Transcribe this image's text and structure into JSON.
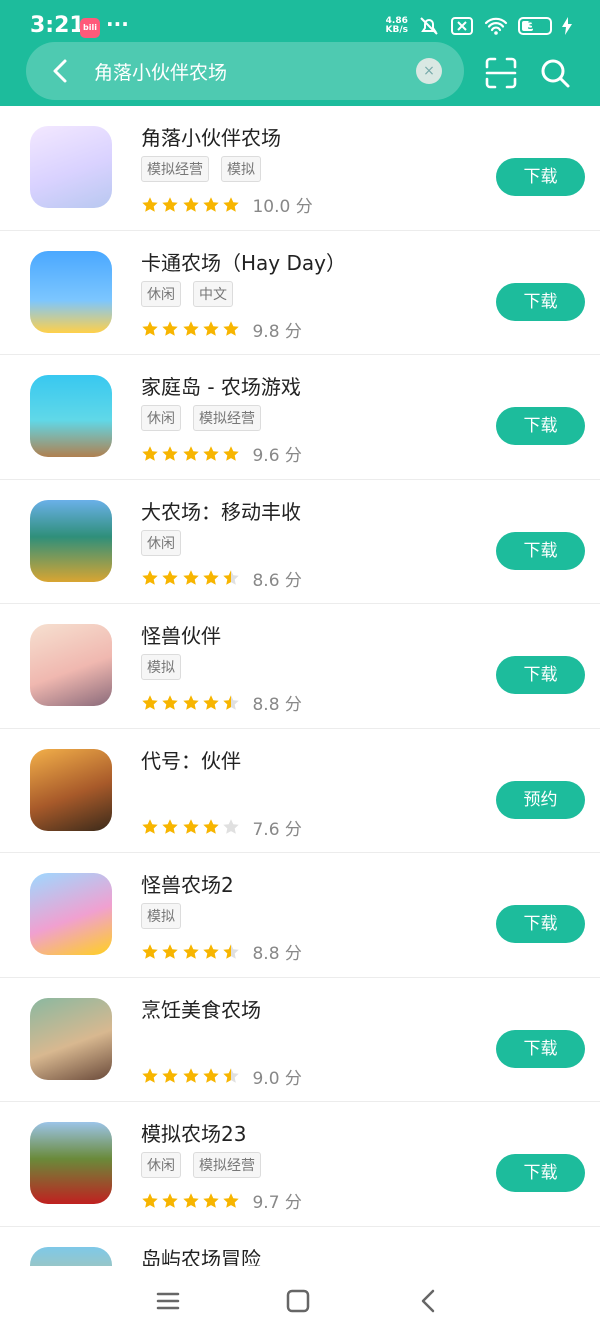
{
  "status_bar": {
    "time": "3:21",
    "app_badge": "bilibili",
    "dots": "···",
    "net_speed_top": "4.86",
    "net_speed_bottom": "KB/s",
    "battery": "38"
  },
  "search": {
    "query": "角落小伙伴农场",
    "clear_symbol": "×"
  },
  "colors": {
    "accent": "#1dbc9c",
    "star": "#f7b500",
    "star_empty": "#e0e0e0"
  },
  "results": [
    {
      "name": "角落小伙伴农场",
      "tags": [
        "模拟经营",
        "模拟"
      ],
      "stars": [
        1,
        1,
        1,
        1,
        1
      ],
      "score": "10.0 分",
      "action": "下载"
    },
    {
      "name": "卡通农场（Hay Day）",
      "tags": [
        "休闲",
        "中文"
      ],
      "stars": [
        1,
        1,
        1,
        1,
        1
      ],
      "score": "9.8 分",
      "action": "下载"
    },
    {
      "name": "家庭岛 - 农场游戏",
      "tags": [
        "休闲",
        "模拟经营"
      ],
      "stars": [
        1,
        1,
        1,
        1,
        1
      ],
      "score": "9.6 分",
      "action": "下载"
    },
    {
      "name": "大农场：移动丰收",
      "tags": [
        "休闲"
      ],
      "stars": [
        1,
        1,
        1,
        1,
        0.5
      ],
      "score": "8.6 分",
      "action": "下载"
    },
    {
      "name": "怪兽伙伴",
      "tags": [
        "模拟"
      ],
      "stars": [
        1,
        1,
        1,
        1,
        0.5
      ],
      "score": "8.8 分",
      "action": "下载"
    },
    {
      "name": " 代号：伙伴",
      "tags": [],
      "stars": [
        1,
        1,
        1,
        1,
        0
      ],
      "score": "7.6 分",
      "action": "预约"
    },
    {
      "name": "怪兽农场2",
      "tags": [
        "模拟"
      ],
      "stars": [
        1,
        1,
        1,
        1,
        0.5
      ],
      "score": "8.8 分",
      "action": "下载"
    },
    {
      "name": "烹饪美食农场",
      "tags": [],
      "stars": [
        1,
        1,
        1,
        1,
        0.5
      ],
      "score": "9.0 分",
      "action": "下载"
    },
    {
      "name": "模拟农场23",
      "tags": [
        "休闲",
        "模拟经营"
      ],
      "stars": [
        1,
        1,
        1,
        1,
        1
      ],
      "score": "9.7 分",
      "action": "下载"
    },
    {
      "name": "岛屿农场冒险",
      "tags": [],
      "stars": [],
      "score": "",
      "action": ""
    }
  ]
}
